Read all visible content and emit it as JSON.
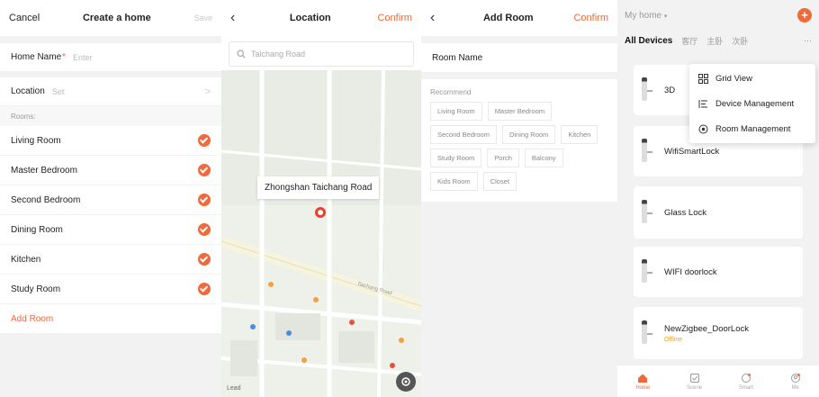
{
  "panel1": {
    "header": {
      "cancel": "Cancel",
      "title": "Create a home",
      "save": "Save"
    },
    "home_name": {
      "label": "Home Name",
      "required_mark": "*",
      "placeholder": "Enter"
    },
    "location": {
      "label": "Location",
      "value": "Set",
      "chevron": ">"
    },
    "rooms_label": "Rooms:",
    "rooms": [
      "Living Room",
      "Master Bedroom",
      "Second Bedroom",
      "Dining Room",
      "Kitchen",
      "Study Room"
    ],
    "add_room": "Add Room"
  },
  "panel2": {
    "header": {
      "title": "Location",
      "confirm": "Confirm"
    },
    "search_placeholder": "Taichang Road",
    "callout": "Zhongshan Taichang Road",
    "map_labels": {
      "road": "Taichang Road",
      "map_logo": "Lead"
    }
  },
  "panel3": {
    "header": {
      "title": "Add Room",
      "confirm": "Confirm"
    },
    "room_name_label": "Room Name",
    "recommend_label": "Recommend",
    "chips": [
      "Living Room",
      "Master Bedroom",
      "Second Bedroom",
      "Dining Room",
      "Kitchen",
      "Study Room",
      "Porch",
      "Balcony",
      "Kids Room",
      "Closet"
    ]
  },
  "panel4": {
    "home_title": "My home",
    "home_caret": "▾",
    "plus": "+",
    "tabs": [
      "All Devices",
      "客厅",
      "主卧",
      "次卧"
    ],
    "more": "···",
    "devices": [
      {
        "name": "3D",
        "status": ""
      },
      {
        "name": "WifiSmartLock",
        "status": ""
      },
      {
        "name": "Glass Lock",
        "status": ""
      },
      {
        "name": "WIFI doorlock",
        "status": ""
      },
      {
        "name": "NewZigbee_DoorLock",
        "status": "Offline"
      }
    ],
    "menu": [
      "Grid View",
      "Device Management",
      "Room Management"
    ],
    "nav": [
      "Home",
      "Scene",
      "Smart",
      "Me"
    ]
  },
  "colors": {
    "accent": "#f06a3c",
    "offline": "#f0a020"
  }
}
